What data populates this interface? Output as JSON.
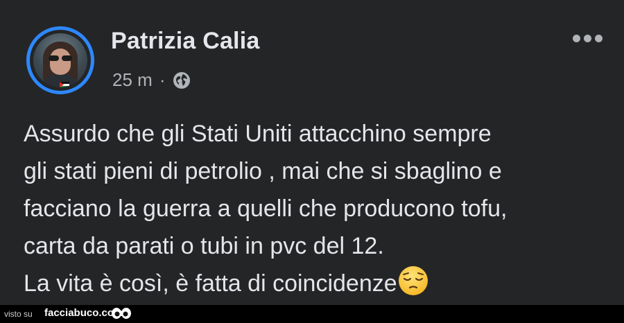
{
  "post": {
    "author": "Patrizia Calia",
    "time": "25 m",
    "separator": "·",
    "privacy_icon": "globe-icon",
    "menu_icon": "more-options-icon",
    "lines": [
      "Assurdo che gli Stati Uniti attacchino sempre",
      "gli stati pieni di petrolio , mai che si sbaglino e",
      "facciano la guerra a quelli che producono tofu,",
      "carta da parati o tubi in pvc del 12.",
      "La vita è così, è fatta di coincidenze"
    ],
    "emoji": "pensive-face"
  },
  "colors": {
    "background": "#242526",
    "text": "#e4e6eb",
    "secondary_text": "#b0b3b8",
    "avatar_ring": "#2d88ff"
  },
  "footer": {
    "visto": "visto su",
    "brand": "facciabuco.com"
  }
}
